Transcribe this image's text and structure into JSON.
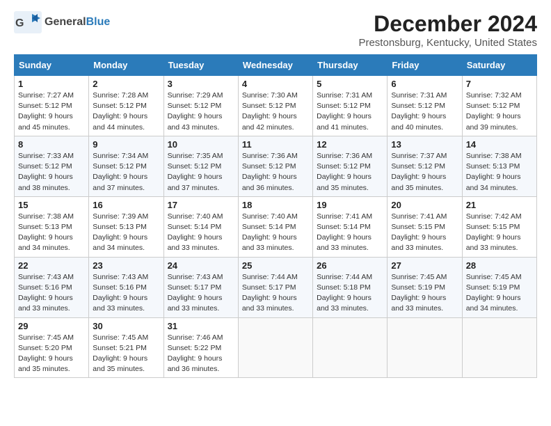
{
  "header": {
    "logo_general": "General",
    "logo_blue": "Blue",
    "month_title": "December 2024",
    "location": "Prestonsburg, Kentucky, United States"
  },
  "calendar": {
    "days_of_week": [
      "Sunday",
      "Monday",
      "Tuesday",
      "Wednesday",
      "Thursday",
      "Friday",
      "Saturday"
    ],
    "weeks": [
      [
        {
          "day": "1",
          "sunrise": "7:27 AM",
          "sunset": "5:12 PM",
          "daylight": "9 hours and 45 minutes."
        },
        {
          "day": "2",
          "sunrise": "7:28 AM",
          "sunset": "5:12 PM",
          "daylight": "9 hours and 44 minutes."
        },
        {
          "day": "3",
          "sunrise": "7:29 AM",
          "sunset": "5:12 PM",
          "daylight": "9 hours and 43 minutes."
        },
        {
          "day": "4",
          "sunrise": "7:30 AM",
          "sunset": "5:12 PM",
          "daylight": "9 hours and 42 minutes."
        },
        {
          "day": "5",
          "sunrise": "7:31 AM",
          "sunset": "5:12 PM",
          "daylight": "9 hours and 41 minutes."
        },
        {
          "day": "6",
          "sunrise": "7:31 AM",
          "sunset": "5:12 PM",
          "daylight": "9 hours and 40 minutes."
        },
        {
          "day": "7",
          "sunrise": "7:32 AM",
          "sunset": "5:12 PM",
          "daylight": "9 hours and 39 minutes."
        }
      ],
      [
        {
          "day": "8",
          "sunrise": "7:33 AM",
          "sunset": "5:12 PM",
          "daylight": "9 hours and 38 minutes."
        },
        {
          "day": "9",
          "sunrise": "7:34 AM",
          "sunset": "5:12 PM",
          "daylight": "9 hours and 37 minutes."
        },
        {
          "day": "10",
          "sunrise": "7:35 AM",
          "sunset": "5:12 PM",
          "daylight": "9 hours and 37 minutes."
        },
        {
          "day": "11",
          "sunrise": "7:36 AM",
          "sunset": "5:12 PM",
          "daylight": "9 hours and 36 minutes."
        },
        {
          "day": "12",
          "sunrise": "7:36 AM",
          "sunset": "5:12 PM",
          "daylight": "9 hours and 35 minutes."
        },
        {
          "day": "13",
          "sunrise": "7:37 AM",
          "sunset": "5:12 PM",
          "daylight": "9 hours and 35 minutes."
        },
        {
          "day": "14",
          "sunrise": "7:38 AM",
          "sunset": "5:13 PM",
          "daylight": "9 hours and 34 minutes."
        }
      ],
      [
        {
          "day": "15",
          "sunrise": "7:38 AM",
          "sunset": "5:13 PM",
          "daylight": "9 hours and 34 minutes."
        },
        {
          "day": "16",
          "sunrise": "7:39 AM",
          "sunset": "5:13 PM",
          "daylight": "9 hours and 34 minutes."
        },
        {
          "day": "17",
          "sunrise": "7:40 AM",
          "sunset": "5:14 PM",
          "daylight": "9 hours and 33 minutes."
        },
        {
          "day": "18",
          "sunrise": "7:40 AM",
          "sunset": "5:14 PM",
          "daylight": "9 hours and 33 minutes."
        },
        {
          "day": "19",
          "sunrise": "7:41 AM",
          "sunset": "5:14 PM",
          "daylight": "9 hours and 33 minutes."
        },
        {
          "day": "20",
          "sunrise": "7:41 AM",
          "sunset": "5:15 PM",
          "daylight": "9 hours and 33 minutes."
        },
        {
          "day": "21",
          "sunrise": "7:42 AM",
          "sunset": "5:15 PM",
          "daylight": "9 hours and 33 minutes."
        }
      ],
      [
        {
          "day": "22",
          "sunrise": "7:43 AM",
          "sunset": "5:16 PM",
          "daylight": "9 hours and 33 minutes."
        },
        {
          "day": "23",
          "sunrise": "7:43 AM",
          "sunset": "5:16 PM",
          "daylight": "9 hours and 33 minutes."
        },
        {
          "day": "24",
          "sunrise": "7:43 AM",
          "sunset": "5:17 PM",
          "daylight": "9 hours and 33 minutes."
        },
        {
          "day": "25",
          "sunrise": "7:44 AM",
          "sunset": "5:17 PM",
          "daylight": "9 hours and 33 minutes."
        },
        {
          "day": "26",
          "sunrise": "7:44 AM",
          "sunset": "5:18 PM",
          "daylight": "9 hours and 33 minutes."
        },
        {
          "day": "27",
          "sunrise": "7:45 AM",
          "sunset": "5:19 PM",
          "daylight": "9 hours and 33 minutes."
        },
        {
          "day": "28",
          "sunrise": "7:45 AM",
          "sunset": "5:19 PM",
          "daylight": "9 hours and 34 minutes."
        }
      ],
      [
        {
          "day": "29",
          "sunrise": "7:45 AM",
          "sunset": "5:20 PM",
          "daylight": "9 hours and 35 minutes."
        },
        {
          "day": "30",
          "sunrise": "7:45 AM",
          "sunset": "5:21 PM",
          "daylight": "9 hours and 35 minutes."
        },
        {
          "day": "31",
          "sunrise": "7:46 AM",
          "sunset": "5:22 PM",
          "daylight": "9 hours and 36 minutes."
        },
        null,
        null,
        null,
        null
      ]
    ]
  }
}
